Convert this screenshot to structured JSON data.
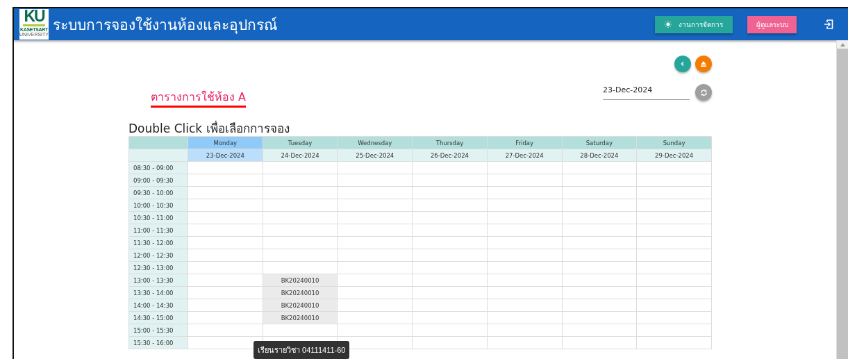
{
  "header": {
    "logo": {
      "mark": "KU",
      "caption": "KASETSART",
      "caption_2": "UNIVERSITY"
    },
    "title": "ระบบการจองใช้งานห้องและอุปกรณ์",
    "buttons": [
      {
        "label": "งานการจัดการ",
        "kind": "manage"
      },
      {
        "label": "ผู้ดูแลระบบ",
        "kind": "admin"
      }
    ]
  },
  "toolbar": {
    "date_field": {
      "value": "23-Dec-2024"
    }
  },
  "room_title": "ตารางการใช้ห้อง A",
  "instruction": "Double Click เพื่อเลือกการจอง",
  "table": {
    "days": [
      {
        "name": "Monday",
        "date": "23-Dec-2024",
        "selected": true
      },
      {
        "name": "Tuesday",
        "date": "24-Dec-2024",
        "selected": false
      },
      {
        "name": "Wednesday",
        "date": "25-Dec-2024",
        "selected": false
      },
      {
        "name": "Thursday",
        "date": "26-Dec-2024",
        "selected": false
      },
      {
        "name": "Friday",
        "date": "27-Dec-2024",
        "selected": false
      },
      {
        "name": "Saturday",
        "date": "28-Dec-2024",
        "selected": false
      },
      {
        "name": "Sunday",
        "date": "29-Dec-2024",
        "selected": false
      }
    ],
    "rows": [
      {
        "time": "08:30 - 09:00",
        "cells": [
          {
            "booked": false
          },
          {
            "booked": false
          },
          {
            "booked": false
          },
          {
            "booked": false
          },
          {
            "booked": false
          },
          {
            "booked": false
          },
          {
            "booked": false
          }
        ]
      },
      {
        "time": "09:00 - 09:30",
        "cells": [
          {
            "booked": false
          },
          {
            "booked": false
          },
          {
            "booked": false
          },
          {
            "booked": false
          },
          {
            "booked": false
          },
          {
            "booked": false
          },
          {
            "booked": false
          }
        ]
      },
      {
        "time": "09:30 - 10:00",
        "cells": [
          {
            "booked": false
          },
          {
            "booked": false
          },
          {
            "booked": false
          },
          {
            "booked": false
          },
          {
            "booked": false
          },
          {
            "booked": false
          },
          {
            "booked": false
          }
        ]
      },
      {
        "time": "10:00 - 10:30",
        "cells": [
          {
            "booked": false
          },
          {
            "booked": false
          },
          {
            "booked": false
          },
          {
            "booked": false
          },
          {
            "booked": false
          },
          {
            "booked": false
          },
          {
            "booked": false
          }
        ]
      },
      {
        "time": "10:30 - 11:00",
        "cells": [
          {
            "booked": false
          },
          {
            "booked": false
          },
          {
            "booked": false
          },
          {
            "booked": false
          },
          {
            "booked": false
          },
          {
            "booked": false
          },
          {
            "booked": false
          }
        ]
      },
      {
        "time": "11:00 - 11:30",
        "cells": [
          {
            "booked": false
          },
          {
            "booked": false
          },
          {
            "booked": false
          },
          {
            "booked": false
          },
          {
            "booked": false
          },
          {
            "booked": false
          },
          {
            "booked": false
          }
        ]
      },
      {
        "time": "11:30 - 12:00",
        "cells": [
          {
            "booked": false
          },
          {
            "booked": false
          },
          {
            "booked": false
          },
          {
            "booked": false
          },
          {
            "booked": false
          },
          {
            "booked": false
          },
          {
            "booked": false
          }
        ]
      },
      {
        "time": "12:00 - 12:30",
        "cells": [
          {
            "booked": false
          },
          {
            "booked": false
          },
          {
            "booked": false
          },
          {
            "booked": false
          },
          {
            "booked": false
          },
          {
            "booked": false
          },
          {
            "booked": false
          }
        ]
      },
      {
        "time": "12:30 - 13:00",
        "cells": [
          {
            "booked": false
          },
          {
            "booked": false
          },
          {
            "booked": false
          },
          {
            "booked": false
          },
          {
            "booked": false
          },
          {
            "booked": false
          },
          {
            "booked": false
          }
        ]
      },
      {
        "time": "13:00 - 13:30",
        "cells": [
          {
            "booked": false
          },
          {
            "booked": true,
            "code": "BK20240010"
          },
          {
            "booked": false
          },
          {
            "booked": false
          },
          {
            "booked": false
          },
          {
            "booked": false
          },
          {
            "booked": false
          }
        ]
      },
      {
        "time": "13:30 - 14:00",
        "cells": [
          {
            "booked": false
          },
          {
            "booked": true,
            "code": "BK20240010"
          },
          {
            "booked": false
          },
          {
            "booked": false
          },
          {
            "booked": false
          },
          {
            "booked": false
          },
          {
            "booked": false
          }
        ]
      },
      {
        "time": "14:00 - 14:30",
        "cells": [
          {
            "booked": false
          },
          {
            "booked": true,
            "code": "BK20240010"
          },
          {
            "booked": false
          },
          {
            "booked": false
          },
          {
            "booked": false
          },
          {
            "booked": false
          },
          {
            "booked": false
          }
        ]
      },
      {
        "time": "14:30 - 15:00",
        "cells": [
          {
            "booked": false
          },
          {
            "booked": true,
            "code": "BK20240010"
          },
          {
            "booked": false
          },
          {
            "booked": false
          },
          {
            "booked": false
          },
          {
            "booked": false
          },
          {
            "booked": false
          }
        ]
      },
      {
        "time": "15:00 - 15:30",
        "cells": [
          {
            "booked": false
          },
          {
            "booked": false
          },
          {
            "booked": false
          },
          {
            "booked": false
          },
          {
            "booked": false
          },
          {
            "booked": false
          },
          {
            "booked": false
          }
        ]
      },
      {
        "time": "15:30 - 16:00",
        "cells": [
          {
            "booked": false
          },
          {
            "booked": false
          },
          {
            "booked": false
          },
          {
            "booked": false
          },
          {
            "booked": false
          },
          {
            "booked": false
          },
          {
            "booked": false
          }
        ]
      }
    ]
  },
  "tooltip": "เรียนรายวิชา 04111411-60"
}
